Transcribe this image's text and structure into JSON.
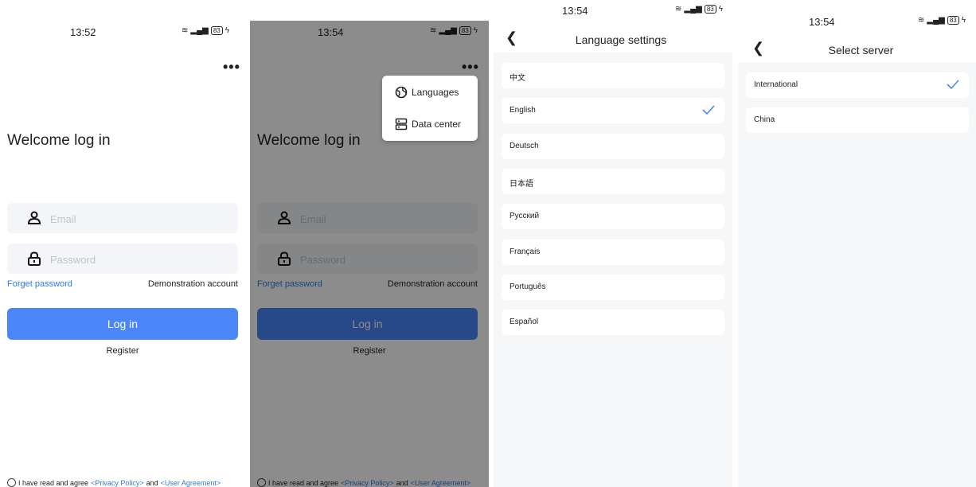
{
  "panel1": {
    "status": {
      "time": "13:52",
      "battery": "83"
    },
    "title": "Welcome log in",
    "email_placeholder": "Email",
    "password_placeholder": "Password",
    "forget_password": "Forget password",
    "demo_account": "Demonstration account",
    "login": "Log in",
    "register": "Register",
    "agree_text": "I have read and agree",
    "privacy_policy": "<Privacy Policy>",
    "and": "and",
    "user_agreement": "<User Agreement>"
  },
  "panel2": {
    "status": {
      "time": "13:54",
      "battery": "83"
    },
    "title": "Welcome log in",
    "email_placeholder": "Email",
    "password_placeholder": "Password",
    "forget_password": "Forget password",
    "demo_account": "Demonstration account",
    "login": "Log in",
    "register": "Register",
    "agree_text": "I have read and agree",
    "privacy_policy": "<Privacy Policy>",
    "and": "and",
    "user_agreement": "<User Agreement>",
    "menu": {
      "languages": "Languages",
      "data_center": "Data center"
    }
  },
  "panel3": {
    "status": {
      "time": "13:54",
      "battery": "83"
    },
    "title": "Language settings",
    "languages": [
      "中文",
      "English",
      "Deutsch",
      "日本語",
      "Русский",
      "Français",
      "Português",
      "Español"
    ],
    "selected": "English"
  },
  "panel4": {
    "status": {
      "time": "13:54",
      "battery": "83"
    },
    "title": "Select server",
    "servers": [
      "International",
      "China"
    ],
    "selected": "International"
  },
  "colors": {
    "accent": "#4a86f7",
    "link": "#2c7be5",
    "check": "#4a86f7"
  }
}
